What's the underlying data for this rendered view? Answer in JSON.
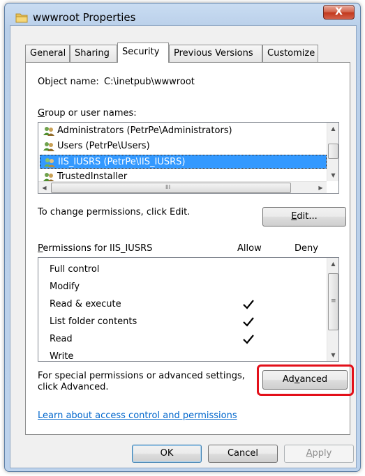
{
  "window": {
    "title": "wwwroot Properties",
    "close_glyph": "X"
  },
  "tabs": [
    {
      "label": "General"
    },
    {
      "label": "Sharing"
    },
    {
      "label": "Security"
    },
    {
      "label": "Previous Versions"
    },
    {
      "label": "Customize"
    }
  ],
  "object": {
    "label": "Object name:",
    "value": "C:\\inetpub\\wwwroot"
  },
  "groups": {
    "label_key": "G",
    "label_rest": "roup or user names:",
    "items": [
      {
        "name": "Administrators (PetrPe\\Administrators)"
      },
      {
        "name": "Users (PetrPe\\Users)"
      },
      {
        "name": "IIS_IUSRS (PetrPe\\IIS_IUSRS)"
      },
      {
        "name": "TrustedInstaller"
      }
    ],
    "hscroll_grip": "III"
  },
  "change_hint": "To change permissions, click Edit.",
  "edit_button": {
    "key": "E",
    "rest": "dit..."
  },
  "permissions": {
    "label_key": "P",
    "label_rest": "ermissions for IIS_IUSRS",
    "allow_header": "Allow",
    "deny_header": "Deny",
    "rows": [
      {
        "name": "Full control",
        "allow": false,
        "deny": false
      },
      {
        "name": "Modify",
        "allow": false,
        "deny": false
      },
      {
        "name": "Read & execute",
        "allow": true,
        "deny": false
      },
      {
        "name": "List folder contents",
        "allow": true,
        "deny": false
      },
      {
        "name": "Read",
        "allow": true,
        "deny": false
      },
      {
        "name": "Write",
        "allow": false,
        "deny": false
      }
    ]
  },
  "special": {
    "line1": "For special permissions or advanced settings,",
    "line2": "click Advanced."
  },
  "advanced_button": {
    "pre": "Ad",
    "key": "v",
    "post": "anced"
  },
  "learn_link": "Learn about access control and permissions",
  "footer": {
    "ok": "OK",
    "cancel": "Cancel",
    "apply_key": "A",
    "apply_rest": "pply"
  },
  "colors": {
    "selection": "#3399ff",
    "highlight": "#e3101a",
    "link": "#0066cc"
  }
}
